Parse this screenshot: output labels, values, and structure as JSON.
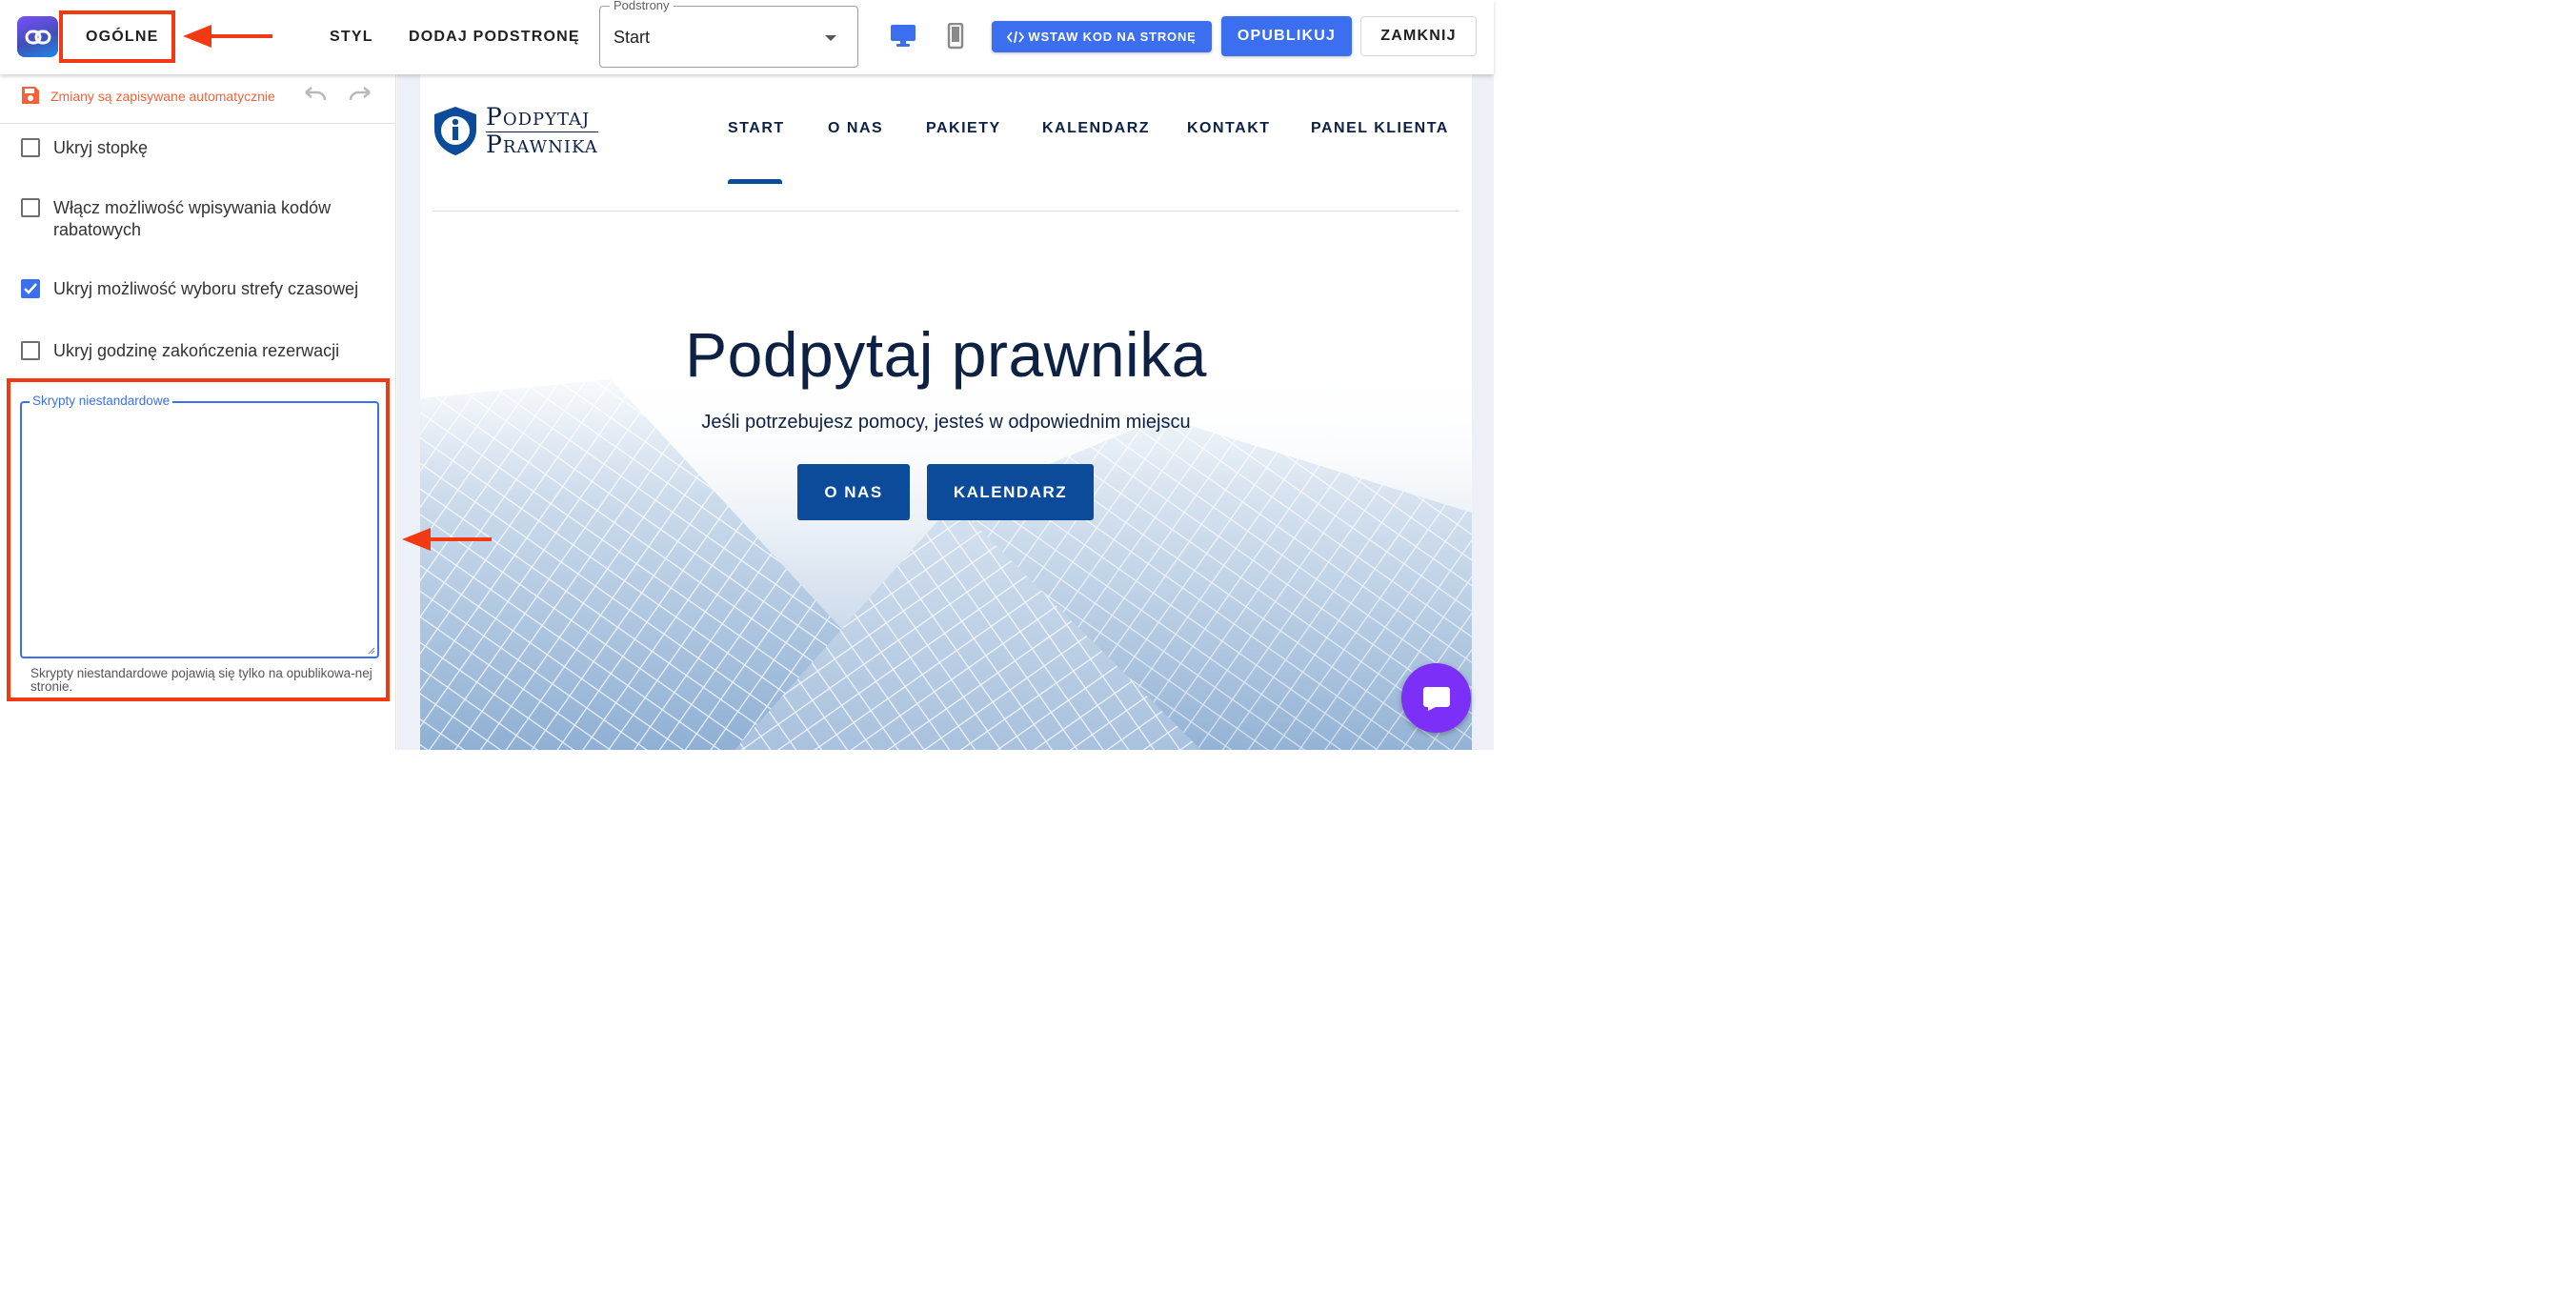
{
  "topbar": {
    "tabs": {
      "general": "OGÓLNE",
      "style": "STYL",
      "add_subpage": "DODAJ PODSTRONĘ"
    },
    "subpages": {
      "legend": "Podstrony",
      "selected": "Start"
    },
    "device_icons": {
      "desktop": "desktop-icon",
      "mobile": "mobile-icon"
    },
    "embed_label": "WSTAW KOD NA STRONĘ",
    "publish_label": "OPUBLIKUJ",
    "close_label": "ZAMKNIJ",
    "accent_color": "#3b6ff0"
  },
  "sidebar": {
    "autosave_text": "Zmiany są zapisywane automatycznie",
    "options": [
      {
        "label": "Ukryj stopkę",
        "checked": false
      },
      {
        "label": "Włącz możliwość wpisywania kodów rabatowych",
        "checked": false
      },
      {
        "label": "Ukryj możliwość wyboru strefy czasowej",
        "checked": true
      },
      {
        "label": "Ukryj godzinę zakończenia rezerwacji",
        "checked": false
      }
    ],
    "custom_scripts": {
      "label": "Skrypty niestandardowe",
      "value": "",
      "hint": "Skrypty niestandardowe pojawią się tylko na opublikowa-nej stronie."
    }
  },
  "annotations": {
    "color": "#f23a12"
  },
  "site": {
    "logo_line1": "Podpytaj",
    "logo_line2": "Prawnika",
    "nav": [
      "START",
      "O NAS",
      "PAKIETY",
      "KALENDARZ",
      "KONTAKT",
      "PANEL KLIENTA"
    ],
    "active_nav": "START",
    "hero_title": "Podpytaj prawnika",
    "hero_subtitle": "Jeśli potrzebujesz pomocy, jesteś w odpowiednim miejscu",
    "hero_buttons": [
      "O NAS",
      "KALENDARZ"
    ],
    "brand_color": "#0b4b9a"
  },
  "chat": {
    "icon": "chat-icon",
    "color": "#7b2ff7"
  }
}
